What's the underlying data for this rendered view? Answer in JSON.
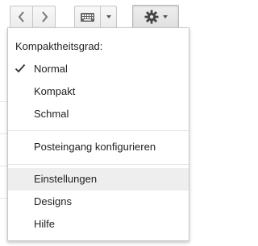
{
  "toolbar": {
    "prev_icon": "chevron-left-icon",
    "next_icon": "chevron-right-icon",
    "keyboard_icon": "keyboard-icon",
    "settings_icon": "gear-icon"
  },
  "menu": {
    "heading": "Kompaktheitsgrad:",
    "density_options": [
      {
        "label": "Normal",
        "selected": true
      },
      {
        "label": "Kompakt",
        "selected": false
      },
      {
        "label": "Schmal",
        "selected": false
      }
    ],
    "configure_inbox": "Posteingang konfigurieren",
    "settings": "Einstellungen",
    "themes": "Designs",
    "help": "Hilfe"
  },
  "colors": {
    "menu_border": "#c8c8c8",
    "hover_background": "#eeeeee",
    "text": "#222222"
  }
}
